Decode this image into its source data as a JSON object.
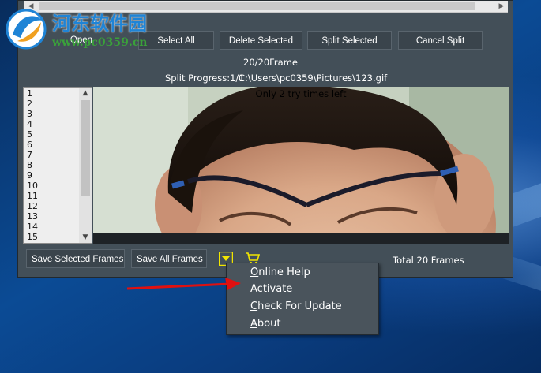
{
  "toolbar": {
    "open": "Open",
    "select_all": "Select All",
    "delete_selected": "Delete Selected",
    "split_selected": "Split Selected",
    "cancel_split": "Cancel Split"
  },
  "status": {
    "frame_count": "20/20Frame",
    "split_progress_label": "Split Progress:1/1",
    "file_path": "C:\\Users\\pc0359\\Pictures\\123.gif",
    "trial_message": "Only 2 try times left"
  },
  "frame_list": {
    "items": [
      "1",
      "2",
      "3",
      "4",
      "5",
      "6",
      "7",
      "8",
      "9",
      "10",
      "11",
      "12",
      "13",
      "14",
      "15"
    ]
  },
  "bottom_bar": {
    "save_selected": "Save Selected Frames",
    "save_all": "Save All Frames",
    "total": "Total 20 Frames",
    "dropdown_icon": "dropdown-triangle-icon",
    "cart_icon": "cart-icon"
  },
  "context_menu": {
    "items": [
      "Online Help",
      "Activate",
      "Check For Update",
      "About"
    ]
  },
  "watermark": {
    "title": "河东软件园",
    "url": "www.pc0359.cn"
  },
  "colors": {
    "app_bg": "#434f58",
    "accent_yellow": "#f2e600",
    "arrow_red": "#e01010",
    "desktop_blue": "#0b4b95"
  }
}
